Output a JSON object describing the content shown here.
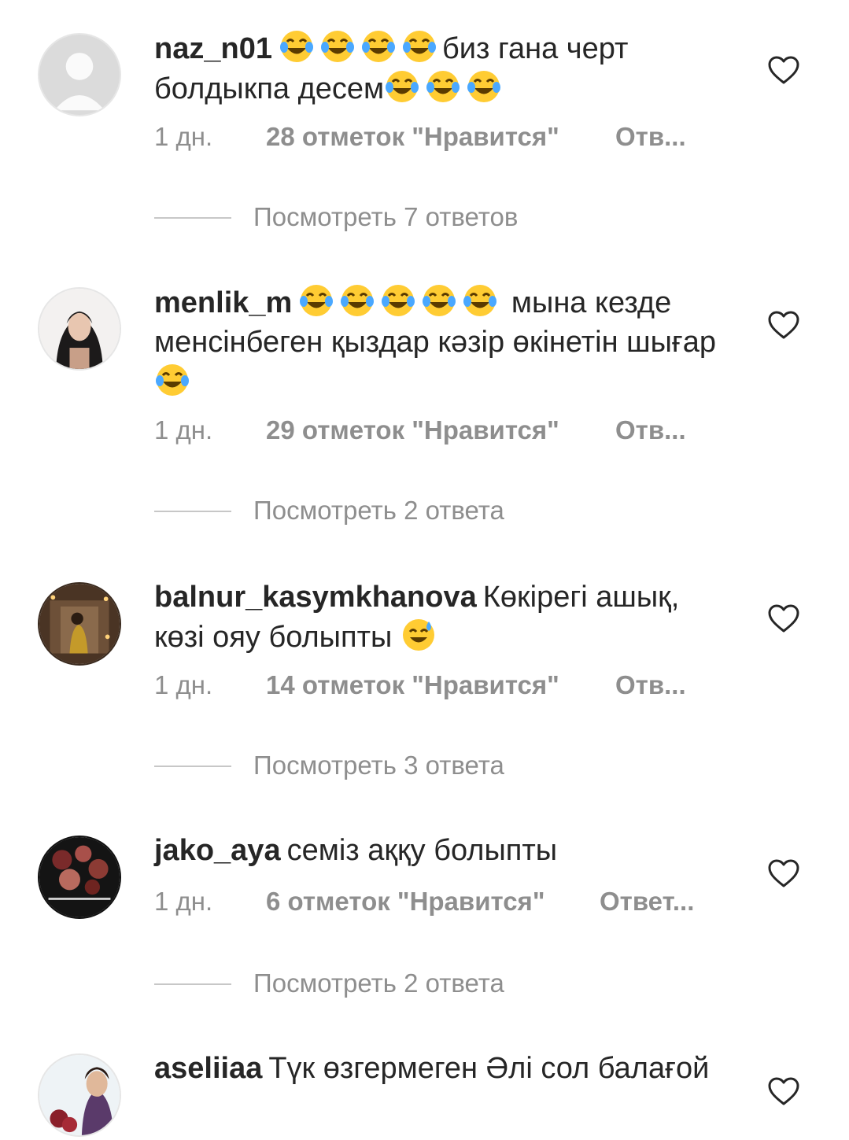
{
  "comments": [
    {
      "username": "naz_n01",
      "text_before": "",
      "emoji_before_count": 4,
      "text_mid": "биз гана черт болдыкпа десем",
      "emoji_after_count": 3,
      "text_after": "",
      "time": "1 дн.",
      "likes": "28 отметок \"Нравится\"",
      "reply": "Отв...",
      "view_replies": "Посмотреть 7 ответов",
      "avatar": "default-avatar-icon"
    },
    {
      "username": "menlik_m",
      "text_before": "",
      "emoji_before_count": 5,
      "text_mid": "мына кезде менсінбеген қыздар кәзір өкінетін шығар",
      "emoji_after_count": 1,
      "text_after": "",
      "time": "1 дн.",
      "likes": "29 отметок \"Нравится\"",
      "reply": "Отв...",
      "view_replies": "Посмотреть 2 ответа",
      "avatar": "photo-avatar"
    },
    {
      "username": "balnur_kasymkhanova",
      "text_mid": "Көкірегі ашық, көзі ояу болыпты",
      "emoji_after_count": 1,
      "time": "1 дн.",
      "likes": "14 отметок \"Нравится\"",
      "reply": "Отв...",
      "view_replies": "Посмотреть 3 ответа",
      "avatar": "photo-avatar"
    },
    {
      "username": "jako_aya",
      "text_mid": "семіз аққу болыпты",
      "time": "1 дн.",
      "likes": "6 отметок \"Нравится\"",
      "reply": "Ответ...",
      "view_replies": "Посмотреть 2 ответа",
      "avatar": "photo-avatar"
    },
    {
      "username": "aseliiaa",
      "text_mid": "Түк өзгермеген Әлі сол балағой",
      "avatar": "photo-avatar"
    }
  ],
  "icons": {
    "heart": "heart-outline-icon",
    "emoji_joy": "face-with-tears-of-joy-icon",
    "emoji_sweat": "grinning-face-with-sweat-icon"
  },
  "colors": {
    "text": "#262626",
    "secondary": "#8e8e8e",
    "divider": "#c7c7c7"
  }
}
